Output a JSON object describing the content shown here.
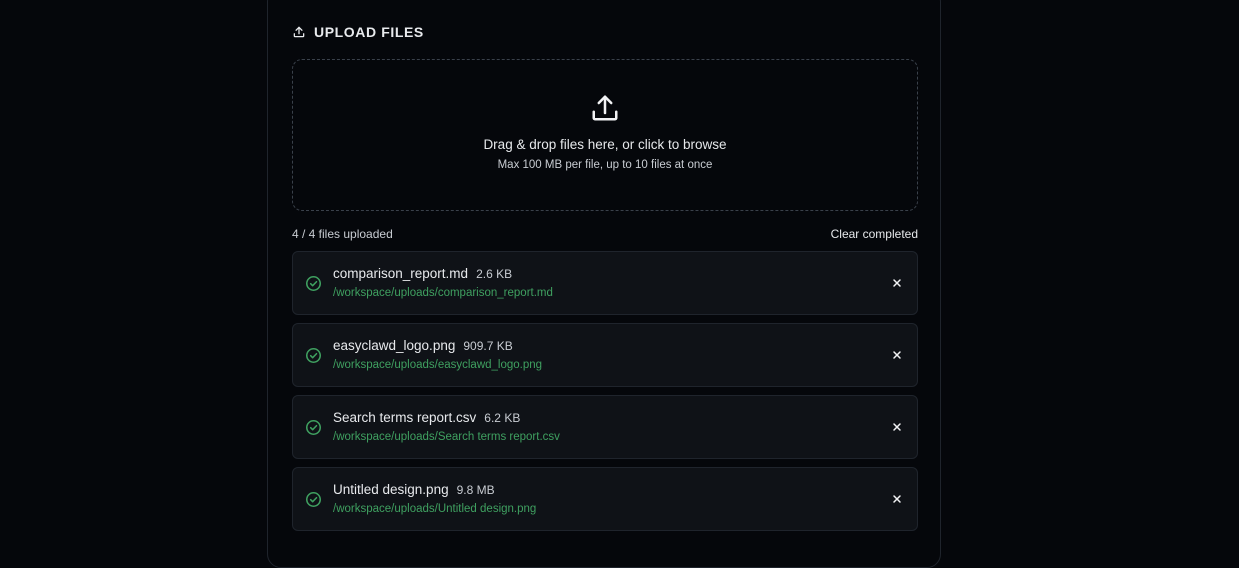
{
  "header": {
    "title": "UPLOAD FILES",
    "icon": "upload-icon"
  },
  "dropzone": {
    "icon": "upload-tray-icon",
    "main_text": "Drag & drop files here, or click to browse",
    "sub_text": "Max 100 MB per file, up to 10 files at once"
  },
  "status": {
    "count_text": "4 / 4 files uploaded",
    "clear_label": "Clear completed"
  },
  "files": [
    {
      "name": "comparison_report.md",
      "size": "2.6 KB",
      "path": "/workspace/uploads/comparison_report.md",
      "status": "uploaded"
    },
    {
      "name": "easyclawd_logo.png",
      "size": "909.7 KB",
      "path": "/workspace/uploads/easyclawd_logo.png",
      "status": "uploaded"
    },
    {
      "name": "Search terms report.csv",
      "size": "6.2 KB",
      "path": "/workspace/uploads/Search terms report.csv",
      "status": "uploaded"
    },
    {
      "name": "Untitled design.png",
      "size": "9.8 MB",
      "path": "/workspace/uploads/Untitled design.png",
      "status": "uploaded"
    }
  ],
  "colors": {
    "background": "#05070b",
    "card_border": "#1f242c",
    "item_background": "#0f1217",
    "success": "#3fa060",
    "text": "#e6e8eb"
  }
}
